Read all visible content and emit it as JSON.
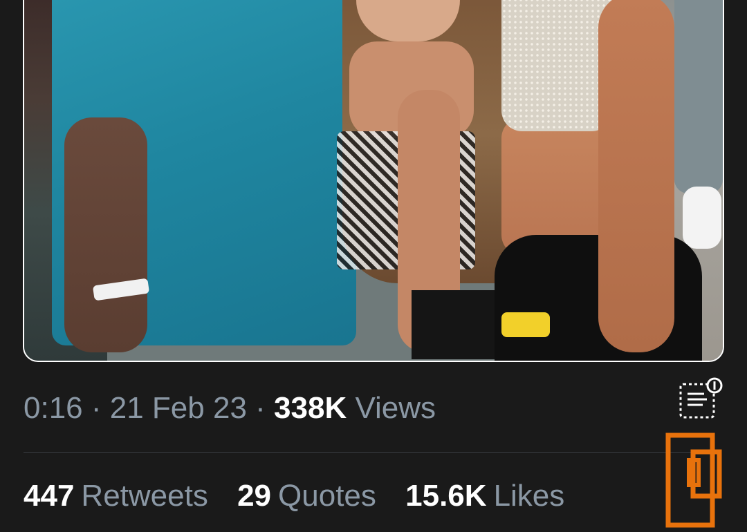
{
  "tweet": {
    "meta": {
      "time": "0:16",
      "separator": "·",
      "date": "21 Feb 23",
      "views_count": "338K",
      "views_label": "Views"
    },
    "stats": [
      {
        "count": "447",
        "label": "Retweets"
      },
      {
        "count": "29",
        "label": "Quotes"
      },
      {
        "count": "15.6K",
        "label": "Likes"
      }
    ]
  },
  "icons": {
    "notes": "notes-list-icon",
    "bookmark": "orange-bookmark-icon"
  },
  "colors": {
    "background": "#1a1a1a",
    "muted_text": "#8b98a5",
    "strong_text": "#ffffff",
    "accent_orange": "#e8720c"
  }
}
